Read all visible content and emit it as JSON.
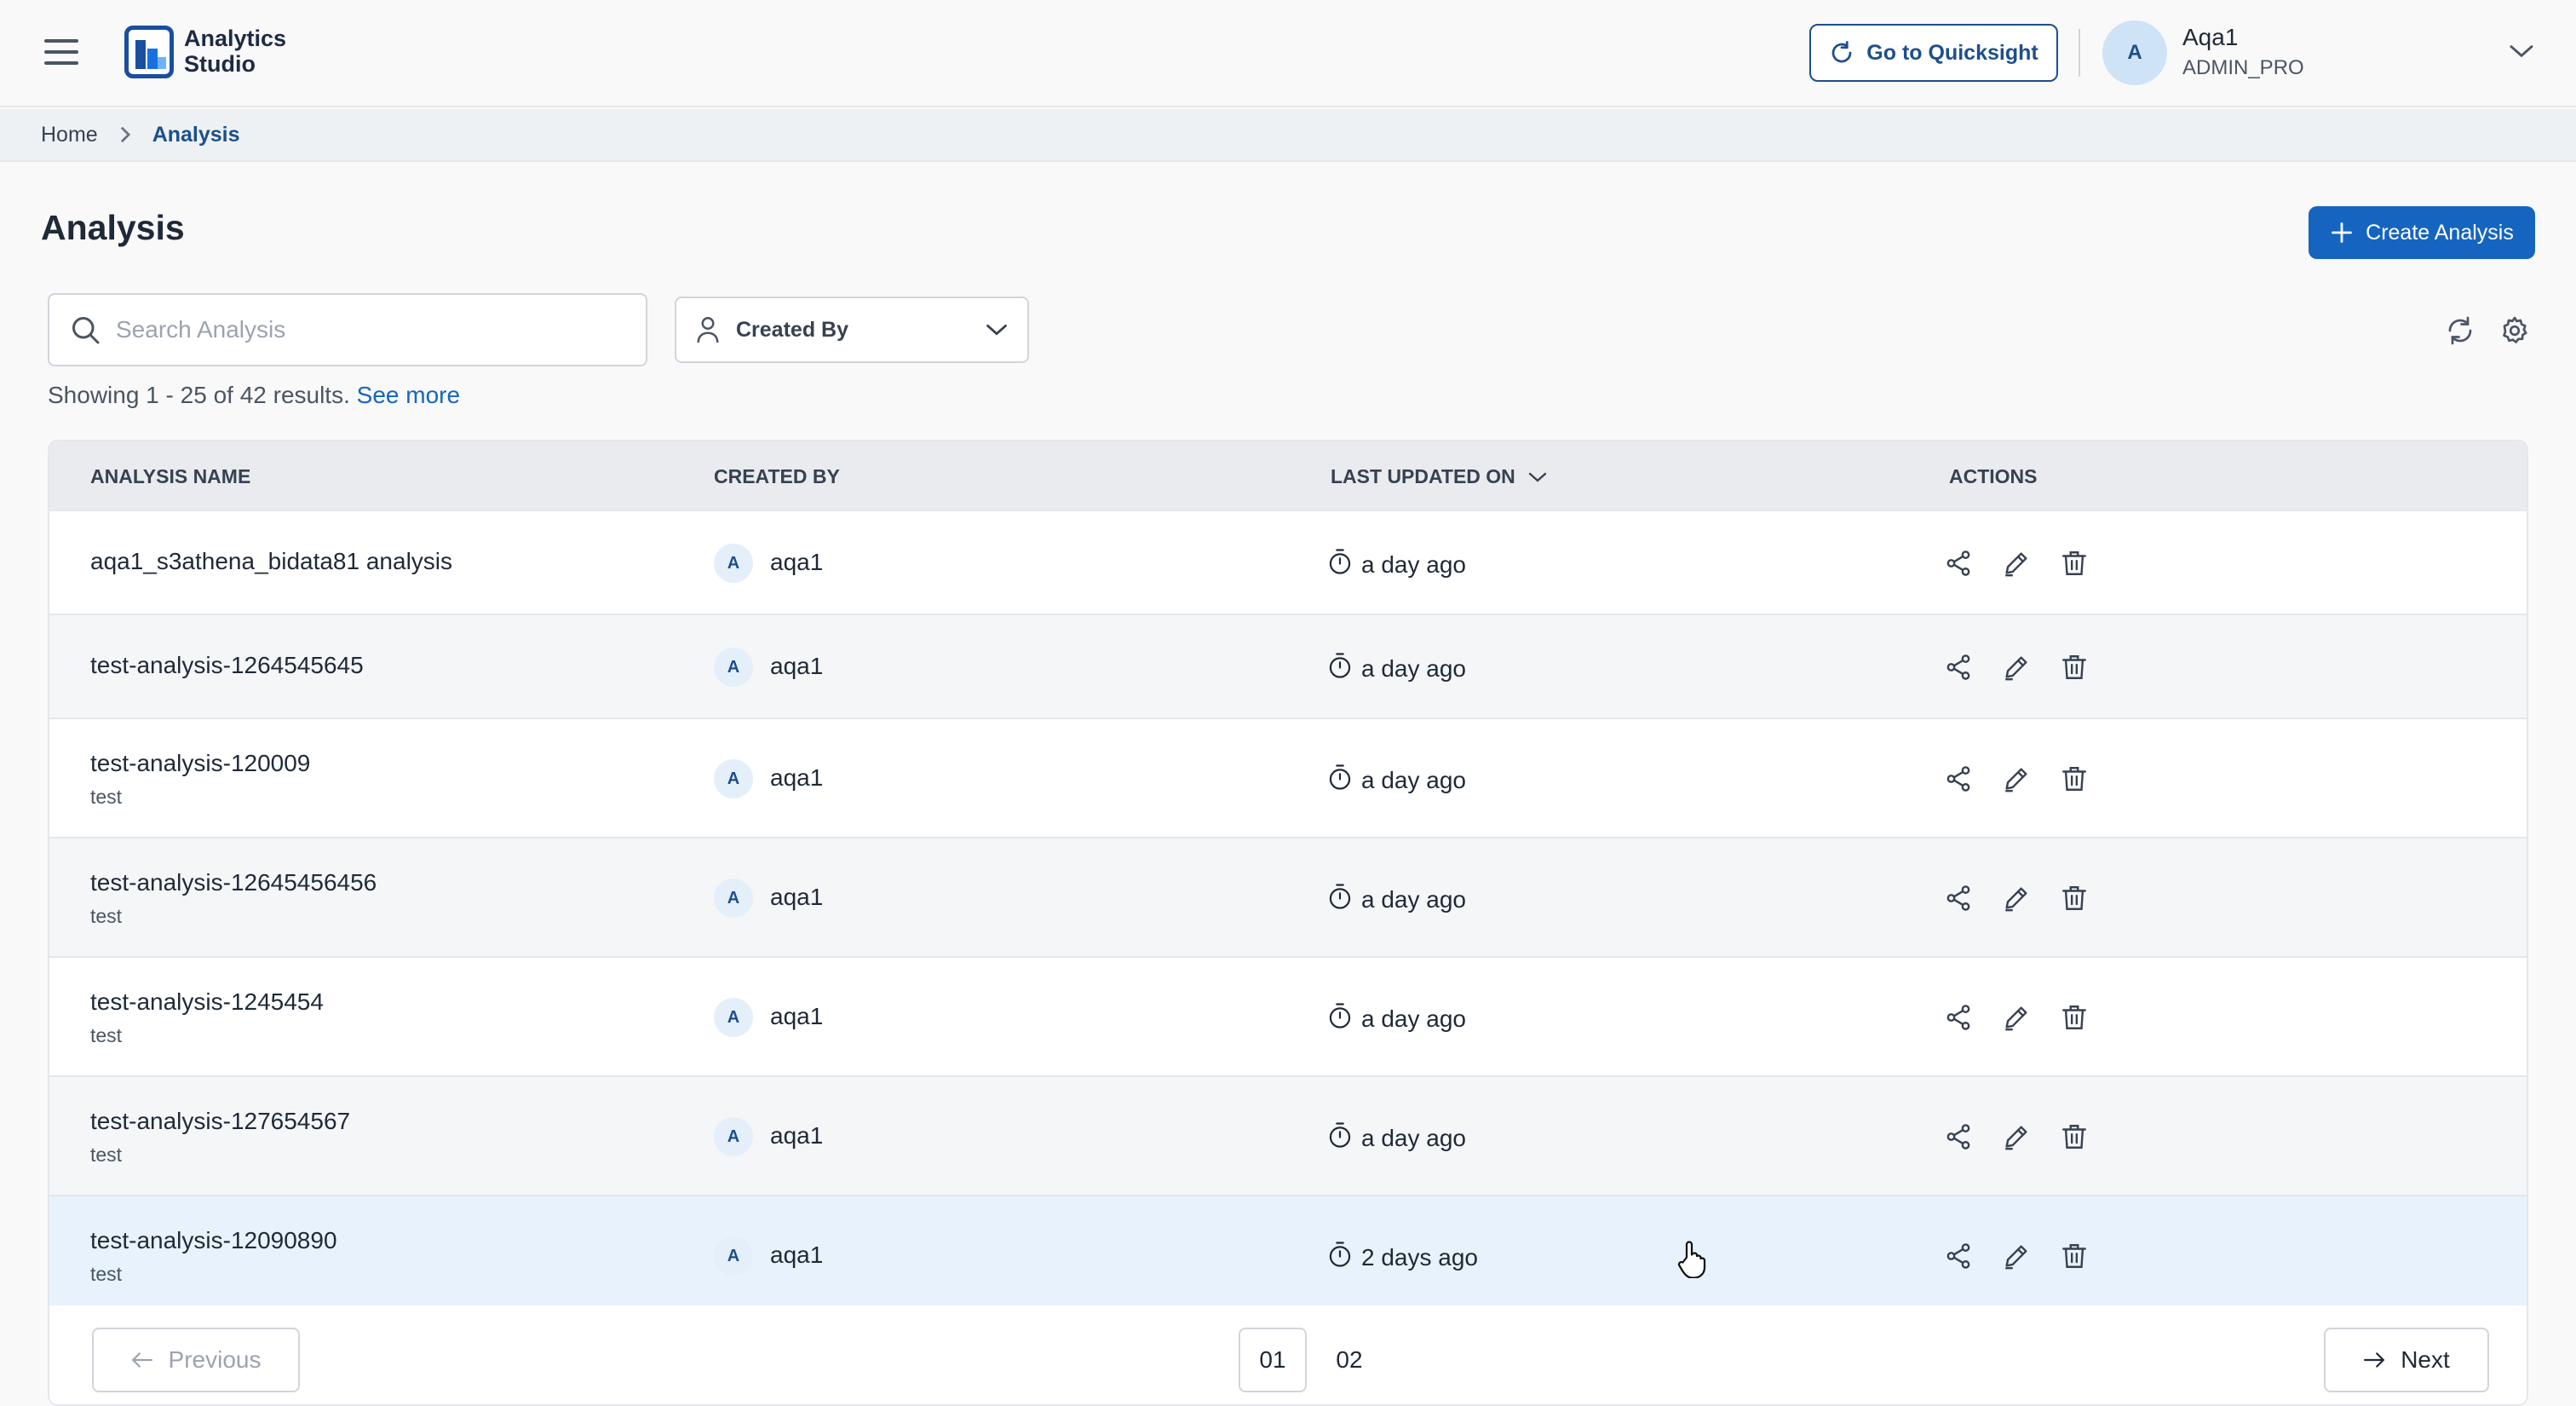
{
  "header": {
    "logo_line1": "Analytics",
    "logo_line2": "Studio",
    "quicksight_label": "Go to Quicksight",
    "user": {
      "initial": "A",
      "name": "Aqa1",
      "role": "ADMIN_PRO"
    }
  },
  "breadcrumb": {
    "home": "Home",
    "current": "Analysis"
  },
  "page": {
    "title": "Analysis",
    "create_label": "Create Analysis",
    "search_placeholder": "Search Analysis",
    "created_by_label": "Created By",
    "results_text": "Showing 1 - 25 of 42 results.",
    "see_more": "See more"
  },
  "table": {
    "columns": [
      "ANALYSIS NAME",
      "CREATED BY",
      "LAST UPDATED ON",
      "ACTIONS"
    ],
    "rows": [
      {
        "name": "aqa1_s3athena_bidata81 analysis",
        "desc": "",
        "creator_initial": "A",
        "creator": "aqa1",
        "updated": "a day ago"
      },
      {
        "name": "test-analysis-1264545645",
        "desc": "",
        "creator_initial": "A",
        "creator": "aqa1",
        "updated": "a day ago"
      },
      {
        "name": "test-analysis-120009",
        "desc": "test",
        "creator_initial": "A",
        "creator": "aqa1",
        "updated": "a day ago"
      },
      {
        "name": "test-analysis-12645456456",
        "desc": "test",
        "creator_initial": "A",
        "creator": "aqa1",
        "updated": "a day ago"
      },
      {
        "name": "test-analysis-1245454",
        "desc": "test",
        "creator_initial": "A",
        "creator": "aqa1",
        "updated": "a day ago"
      },
      {
        "name": "test-analysis-127654567",
        "desc": "test",
        "creator_initial": "A",
        "creator": "aqa1",
        "updated": "a day ago"
      },
      {
        "name": "test-analysis-12090890",
        "desc": "test",
        "creator_initial": "A",
        "creator": "aqa1",
        "updated": "2 days ago"
      }
    ]
  },
  "pagination": {
    "previous": "Previous",
    "next": "Next",
    "pages": [
      "01",
      "02"
    ],
    "current": "01"
  },
  "colors": {
    "primary": "#1565c0",
    "brand_dark": "#1d4f8c",
    "row_highlight": "#e7f2fc"
  },
  "icons": [
    "menu-icon",
    "refresh-icon",
    "search-icon",
    "user-icon",
    "chevron-down-icon",
    "settings-icon",
    "clock-icon",
    "share-icon",
    "edit-icon",
    "delete-icon",
    "arrow-left-icon",
    "arrow-right-icon",
    "plus-icon",
    "hand-cursor-icon"
  ]
}
